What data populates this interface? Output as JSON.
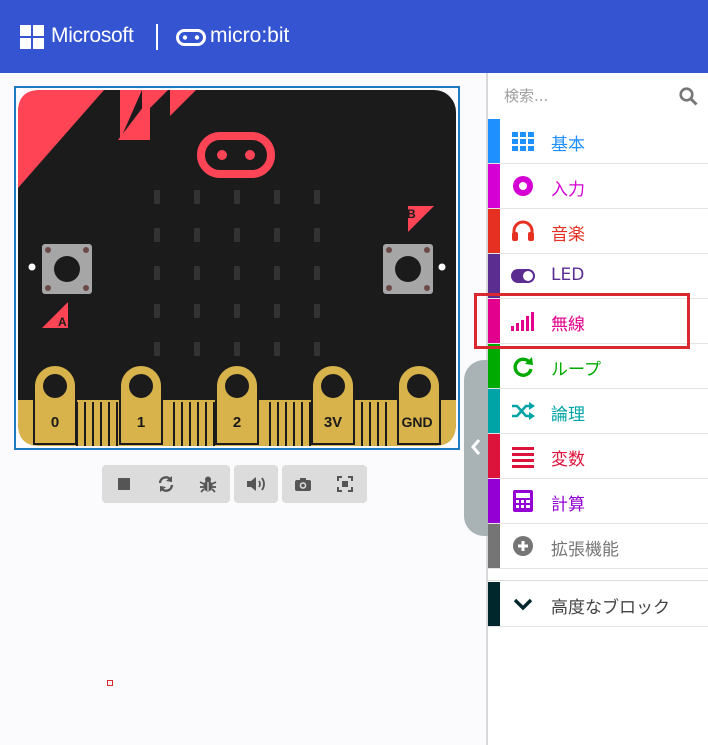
{
  "header": {
    "brand_microsoft": "Microsoft",
    "brand_microbit": "micro:bit",
    "bg_color": "#3454d1"
  },
  "simulator": {
    "pin_labels": [
      "0",
      "1",
      "2",
      "3V",
      "GND"
    ],
    "button_a": "A",
    "button_b": "B",
    "board_color": "#1b1b1b",
    "accent_color": "#ff4456",
    "pin_color": "#d8b24a",
    "toolbar": [
      {
        "name": "stop-icon"
      },
      {
        "name": "restart-icon"
      },
      {
        "name": "debug-icon"
      },
      {
        "name": "mute-icon"
      },
      {
        "name": "screenshot-icon"
      },
      {
        "name": "fullscreen-icon"
      }
    ]
  },
  "toolbox": {
    "search_placeholder": "検索...",
    "categories": [
      {
        "label": "基本",
        "color": "#1e90ff",
        "icon": "grid-icon"
      },
      {
        "label": "入力",
        "color": "#d400d4",
        "icon": "target-icon"
      },
      {
        "label": "音楽",
        "color": "#e63022",
        "icon": "headphones-icon"
      },
      {
        "label": "LED",
        "color": "#5c2d91",
        "icon": "toggle-icon"
      },
      {
        "label": "無線",
        "color": "#e3008c",
        "icon": "signal-icon"
      },
      {
        "label": "ループ",
        "color": "#00aa00",
        "icon": "refresh-icon"
      },
      {
        "label": "論理",
        "color": "#00a4a6",
        "icon": "shuffle-icon"
      },
      {
        "label": "変数",
        "color": "#dc143c",
        "icon": "list-icon"
      },
      {
        "label": "計算",
        "color": "#9400d3",
        "icon": "calculator-icon"
      },
      {
        "label": "拡張機能",
        "color": "#757575",
        "icon": "plus-circle-icon"
      }
    ],
    "advanced": {
      "label": "高度なブロック",
      "color": "#00272b",
      "icon": "chevron-down-icon"
    }
  }
}
